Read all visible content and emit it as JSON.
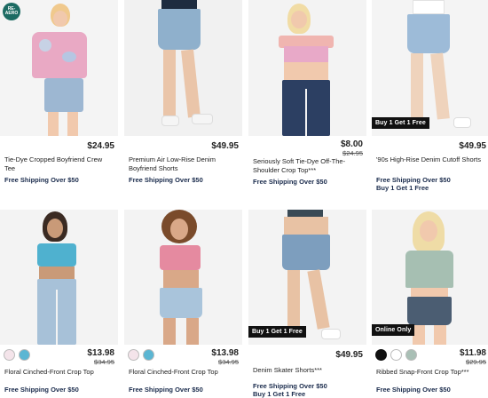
{
  "brand_badge": "RE-AERO",
  "products": [
    {
      "name": "Tie-Dye Cropped Boyfriend Crew Tee",
      "price": "$24.95",
      "shipping": "Free Shipping Over $50",
      "bg": "#f4f4f4",
      "top": "#e9a9c4",
      "bottom": "#9db7d2"
    },
    {
      "name": "Premium Air Low-Rise Denim Boyfriend Shorts",
      "price": "$49.95",
      "shipping": "Free Shipping Over $50",
      "bg": "#f1f1f1",
      "top": "#1d2c40",
      "bottom": "#8fb0cc"
    },
    {
      "name": "Seriously Soft Tie-Dye Off-The-Shoulder Crop Top***",
      "price": "$8.00",
      "old_price": "$24.95",
      "shipping": "Free Shipping Over $50",
      "bg": "#f3f3f3",
      "top": "#f0b5b0",
      "bottom": "#2c3f62"
    },
    {
      "name": "'90s High-Rise Denim Cutoff Shorts",
      "price": "$49.95",
      "shipping": "Free Shipping Over $50",
      "promo": "Buy 1 Get 1 Free",
      "promo_line": "Buy 1 Get 1 Free",
      "bg": "#f4f4f4",
      "top": "#ffffff",
      "bottom": "#9dbbd8"
    },
    {
      "name": "Floral Cinched-Front Crop Top",
      "price": "$13.98",
      "old_price": "$34.95",
      "shipping": "Free Shipping Over $50",
      "swatches": [
        "#f4e4ea",
        "#5bb6d3"
      ],
      "bg": "#f3f3f3",
      "top": "#4fb1cf",
      "bottom": "#a7c1d8"
    },
    {
      "name": "Floral Cinched-Front Crop Top",
      "price": "$13.98",
      "old_price": "$34.95",
      "shipping": "Free Shipping Over $50",
      "swatches": [
        "#f4e4ea",
        "#5bb6d3"
      ],
      "bg": "#f3f3f3",
      "top": "#e58aa0",
      "bottom": "#a9c4db"
    },
    {
      "name": "Denim Skater Shorts***",
      "price": "$49.95",
      "shipping": "Free Shipping Over $50",
      "promo": "Buy 1 Get 1 Free",
      "promo_line": "Buy 1 Get 1 Free",
      "bg": "#f3f3f3",
      "top": "#3a4a55",
      "bottom": "#7d9ebe"
    },
    {
      "name": "Ribbed Snap-Front Crop Top***",
      "price": "$11.98",
      "old_price": "$29.95",
      "shipping": "Free Shipping Over $50",
      "promo": "Online Only",
      "swatches": [
        "#111111",
        "#ffffff",
        "#a9bfb5"
      ],
      "bg": "#f3f3f3",
      "top": "#a6bfb2",
      "bottom": "#4b5d72"
    }
  ]
}
